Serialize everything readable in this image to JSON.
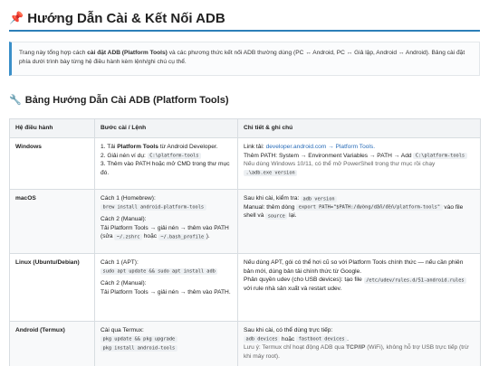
{
  "header": {
    "icon": "pin-icon",
    "title": "Hướng Dẫn Cài & Kết Nối ADB"
  },
  "intro": {
    "pre": "Trang này tổng hợp cách ",
    "bold": "cài đặt ADB (Platform Tools)",
    "post": " và các phương thức kết nối ADB thường dùng (PC ↔ Android, PC ↔ Giả lập, Android ↔ Android). Bảng cài đặt phía dưới trình bày từng hệ điều hành kèm lệnh/ghi chú cụ thể."
  },
  "section": {
    "icon": "wrench-icon",
    "title": "Bảng Hướng Dẫn Cài ADB (Platform Tools)"
  },
  "table": {
    "headers": [
      "Hệ điều hành",
      "Bước cài / Lệnh",
      "Chi tiết & ghi chú"
    ],
    "rows": [
      {
        "os": "Windows",
        "steps": {
          "s1_pre": "1. Tải ",
          "s1_bold": "Platform Tools",
          "s1_post": " từ Android Developer.",
          "s2_pre": "2. Giải nén ví dụ: ",
          "s2_code": "C:\\platform-tools",
          "s3": "3. Thêm vào PATH hoặc mở CMD trong thư mục đó."
        },
        "notes": {
          "n1_pre": "Link tải: ",
          "n1_link": "developer.android.com → Platform Tools.",
          "n2_pre": "Thêm PATH: System → Environment Variables → PATH → Add ",
          "n2_code": "C:\\platform-tools",
          "n3": "Nếu dùng Windows 10/11, có thể mở PowerShell trong thư mục rồi chạy",
          "n3_code": ".\\adb.exe version"
        }
      },
      {
        "os": "macOS",
        "steps": {
          "c1": "Cách 1 (Homebrew):",
          "c1_code": "brew install android-platform-tools",
          "c2": "Cách 2 (Manual):",
          "c2_text": "Tải Platform Tools → giải nén → thêm vào PATH (sửa ",
          "c2_code1": "~/.zshrc",
          "c2_mid": " hoặc ",
          "c2_code2": "~/.bash_profile",
          "c2_end": ")."
        },
        "notes": {
          "n1_pre": "Sau khi cài, kiểm tra: ",
          "n1_code": "adb version",
          "n2_pre": "Manual: thêm dòng ",
          "n2_code": "export PATH=\"$PATH:/đường/dẫn/đến/platform-tools\"",
          "n2_mid": " vào file shell và ",
          "n2_code2": "source",
          "n2_end": " lại."
        }
      },
      {
        "os": "Linux (Ubuntu/Debian)",
        "steps": {
          "c1": "Cách 1 (APT):",
          "c1_code": "sudo apt update && sudo apt install adb",
          "c2": "Cách 2 (Manual):",
          "c2_text": "Tải Platform Tools → giải nén → thêm vào PATH."
        },
        "notes": {
          "n1": "Nếu dùng APT, gói có thể hơi cũ so với Platform Tools chính thức — nếu cần phiên bản mới, dùng bản tải chính thức từ Google.",
          "n2_pre": "Phân quyền udev (cho USB devices): tạo file ",
          "n2_code": "/etc/udev/rules.d/51-android.rules",
          "n2_post": " với rule nhà sản xuất và restart udev."
        }
      },
      {
        "os": "Android (Termux)",
        "steps": {
          "c1": "Cài qua Termux:",
          "c1_code1": "pkg update && pkg upgrade",
          "c1_code2": "pkg install android-tools"
        },
        "notes": {
          "n1": "Sau khi cài, có thể dùng trực tiếp:",
          "n1_code1": "adb devices",
          "n1_mid": " hoặc ",
          "n1_code2": "fastboot devices",
          "n1_end": ".",
          "n2_pre": "Lưu ý: Termux chỉ hoạt động ADB qua ",
          "n2_bold": "TCP/IP",
          "n2_post": " (WiFi), không hỗ trợ USB trực tiếp (trừ khi máy root)."
        }
      }
    ]
  }
}
